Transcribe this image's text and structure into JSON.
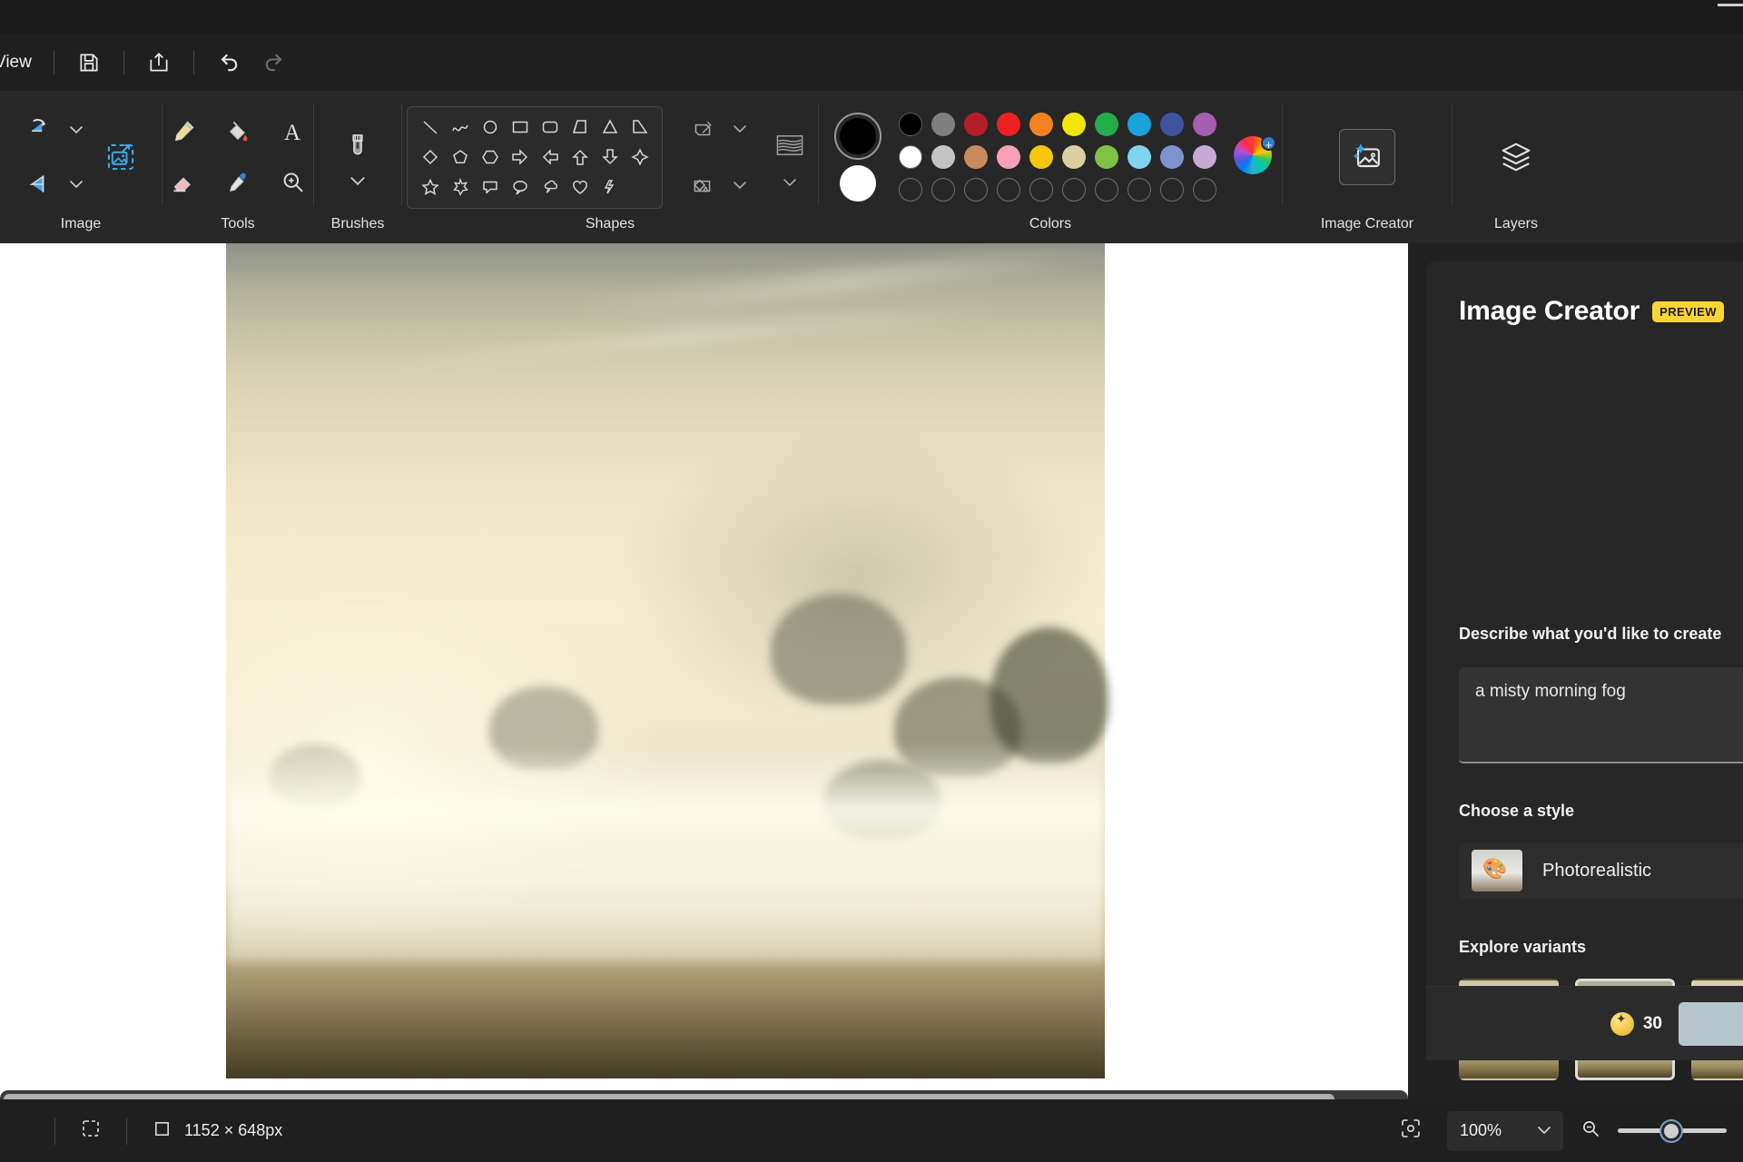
{
  "app": {
    "title_bar": {
      "minimize_label": "—"
    }
  },
  "menu": {
    "items": [
      {
        "label": "View",
        "name": "menu-view"
      }
    ],
    "quick_actions": [
      {
        "name": "save-button",
        "icon": "save-icon",
        "label": "Save"
      },
      {
        "name": "share-button",
        "icon": "share-icon",
        "label": "Share"
      },
      {
        "name": "undo-button",
        "icon": "undo-icon",
        "label": "Undo"
      },
      {
        "name": "redo-button",
        "icon": "redo-icon",
        "label": "Redo"
      }
    ]
  },
  "ribbon": {
    "groups": [
      {
        "name": "image",
        "label": "Image",
        "items": [
          {
            "name": "crop-button",
            "icon": "crop-icon"
          },
          {
            "name": "resize-button",
            "icon": "resize-icon"
          },
          {
            "name": "rotate-button",
            "icon": "rotate-flip-icon"
          },
          {
            "name": "select-button",
            "icon": "select-rectangle-icon"
          }
        ]
      },
      {
        "name": "tools",
        "label": "Tools",
        "items": [
          {
            "name": "pencil-tool",
            "icon": "pencil-icon"
          },
          {
            "name": "fill-tool",
            "icon": "paint-bucket-icon"
          },
          {
            "name": "text-tool",
            "icon": "text-a-icon"
          },
          {
            "name": "eraser-tool",
            "icon": "eraser-icon"
          },
          {
            "name": "eyedropper-tool",
            "icon": "eyedropper-icon"
          },
          {
            "name": "magnifier-tool",
            "icon": "magnifier-icon"
          }
        ]
      },
      {
        "name": "brushes",
        "label": "Brushes",
        "items": [
          {
            "name": "brushes-button",
            "icon": "brush-icon"
          }
        ]
      },
      {
        "name": "shapes",
        "label": "Shapes",
        "items": [
          {
            "name": "shape-line",
            "icon": "line-icon"
          },
          {
            "name": "shape-curve",
            "icon": "curve-icon"
          },
          {
            "name": "shape-oval",
            "icon": "oval-icon"
          },
          {
            "name": "shape-rectangle",
            "icon": "rectangle-icon"
          },
          {
            "name": "shape-rounded-rectangle",
            "icon": "rounded-rectangle-icon"
          },
          {
            "name": "shape-polygon",
            "icon": "polygon-icon"
          },
          {
            "name": "shape-triangle",
            "icon": "triangle-icon"
          },
          {
            "name": "shape-right-triangle",
            "icon": "right-triangle-icon"
          },
          {
            "name": "shape-diamond",
            "icon": "diamond-icon"
          },
          {
            "name": "shape-pentagon",
            "icon": "pentagon-icon"
          },
          {
            "name": "shape-hexagon",
            "icon": "hexagon-icon"
          },
          {
            "name": "shape-arrow-right",
            "icon": "arrow-right-icon"
          },
          {
            "name": "shape-arrow-left",
            "icon": "arrow-left-icon"
          },
          {
            "name": "shape-arrow-up",
            "icon": "arrow-up-icon"
          },
          {
            "name": "shape-arrow-down",
            "icon": "arrow-down-icon"
          },
          {
            "name": "shape-four-point-star",
            "icon": "four-point-star-icon"
          },
          {
            "name": "shape-five-point-star",
            "icon": "five-point-star-icon"
          },
          {
            "name": "shape-six-point-star",
            "icon": "six-point-star-icon"
          },
          {
            "name": "shape-rounded-callout",
            "icon": "rounded-callout-icon"
          },
          {
            "name": "shape-oval-callout",
            "icon": "oval-callout-icon"
          },
          {
            "name": "shape-cloud-callout",
            "icon": "cloud-callout-icon"
          },
          {
            "name": "shape-heart",
            "icon": "heart-icon"
          },
          {
            "name": "shape-lightning",
            "icon": "lightning-icon"
          }
        ],
        "side_controls": [
          {
            "name": "outline-button",
            "icon": "outline-icon"
          },
          {
            "name": "outline-dropdown",
            "icon": "chevron-down-icon"
          },
          {
            "name": "fill-button",
            "icon": "fill-icon"
          },
          {
            "name": "fill-dropdown",
            "icon": "chevron-down-icon"
          },
          {
            "name": "shape-style-button",
            "icon": "shape-style-icon"
          },
          {
            "name": "shape-style-dropdown",
            "icon": "chevron-down-icon"
          }
        ]
      },
      {
        "name": "colors",
        "label": "Colors",
        "primary_color": "#000000",
        "secondary_color": "#ffffff",
        "swatch_rows": [
          [
            "#000000",
            "#7f7f7f",
            "#b41c28",
            "#ed2024",
            "#f58220",
            "#f2e500",
            "#22ac4a",
            "#19a3dc",
            "#3e54a3",
            "#a45fb0"
          ],
          [
            "#ffffff",
            "#c3c3c3",
            "#c98a5c",
            "#f7a0b8",
            "#f5c70a",
            "#d9cfa0",
            "#7dc242",
            "#7fd4f0",
            "#7e93ce",
            "#c7a9d6"
          ],
          [
            null,
            null,
            null,
            null,
            null,
            null,
            null,
            null,
            null,
            null
          ]
        ],
        "color_picker": {
          "name": "color-wheel-button",
          "icon": "color-wheel-icon",
          "badge": "+"
        }
      },
      {
        "name": "image-creator",
        "label": "Image Creator",
        "items": [
          {
            "name": "image-creator-button",
            "icon": "image-creator-icon",
            "selected": true
          }
        ]
      },
      {
        "name": "layers",
        "label": "Layers",
        "items": [
          {
            "name": "layers-button",
            "icon": "layers-icon"
          }
        ]
      }
    ]
  },
  "canvas": {
    "name": "image-canvas",
    "alt": "a misty morning fog landscape with trees",
    "scrollbars": {
      "vertical": "vertical-scrollbar",
      "horizontal": "horizontal-scrollbar"
    }
  },
  "panel": {
    "title": "Image Creator",
    "badge": "PREVIEW",
    "prompt_label": "Describe what you'd like to create",
    "prompt_value": "a misty morning fog",
    "prompt_placeholder": "Describe what you'd like to create",
    "style_label": "Choose a style",
    "style_selected": "Photorealistic",
    "variants_label": "Explore variants",
    "variants": [
      {
        "name": "variant-1",
        "selected": false
      },
      {
        "name": "variant-2",
        "selected": true
      },
      {
        "name": "variant-3",
        "selected": false
      }
    ],
    "credits": "30",
    "create_button_label": ""
  },
  "statusbar": {
    "selection_icon": "selection-icon",
    "canvas_icon": "canvas-size-icon",
    "canvas_size": "1152 × 648px",
    "fit_icon": "fit-to-screen-icon",
    "zoom_value": "100%",
    "zoom_out_icon": "zoom-out-icon",
    "zoom_slider_position": "40"
  },
  "colors": {
    "accent": "#2d7fd3",
    "badge_yellow": "#fcd535",
    "panel_bg": "#272727",
    "ribbon_bg": "#272727"
  }
}
